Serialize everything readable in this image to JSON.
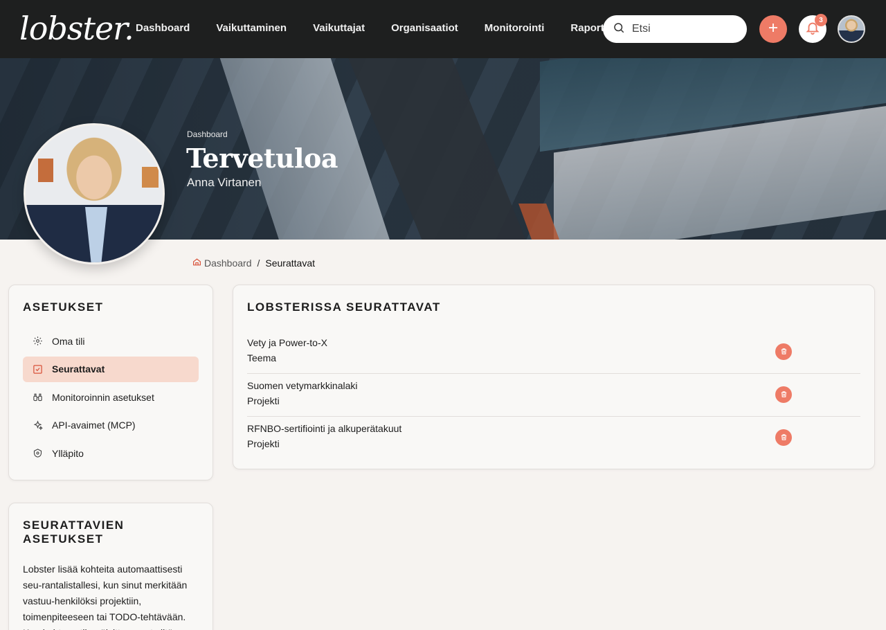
{
  "brand": {
    "logo_text": "lobster."
  },
  "nav": {
    "items": [
      "Dashboard",
      "Vaikuttaminen",
      "Vaikuttajat",
      "Organisaatiot",
      "Monitorointi",
      "Raportit"
    ]
  },
  "search": {
    "placeholder": "Etsi"
  },
  "notifications": {
    "count": "3"
  },
  "colors": {
    "accent": "#ee7b66",
    "active_bg": "#f7d9cd",
    "topbar": "#1e1f1f",
    "page_bg": "#f6f3f0"
  },
  "hero": {
    "crumb": "Dashboard",
    "title": "Tervetuloa",
    "subtitle": "Anna Virtanen"
  },
  "breadcrumb": {
    "home": "Dashboard",
    "separator": "/",
    "current": "Seurattavat"
  },
  "settings": {
    "title": "ASETUKSET",
    "items": [
      {
        "label": "Oma tili",
        "icon": "gear-icon"
      },
      {
        "label": "Seurattavat",
        "icon": "checkbox-icon",
        "active": true
      },
      {
        "label": "Monitoroinnin asetukset",
        "icon": "binoculars-icon"
      },
      {
        "label": "API-avaimet (MCP)",
        "icon": "sparkles-icon"
      },
      {
        "label": "Ylläpito",
        "icon": "shield-icon"
      }
    ]
  },
  "followed": {
    "title": "LOBSTERISSA SEURATTAVAT",
    "rows": [
      {
        "name": "Vety ja Power-to-X",
        "type": "Teema"
      },
      {
        "name": "Suomen vetymarkkinalaki",
        "type": "Projekti"
      },
      {
        "name": "RFNBO-sertifiointi ja alkuperätakuut",
        "type": "Projekti"
      }
    ]
  },
  "info": {
    "title": "SEURATTAVIEN ASETUKSET",
    "text": "Lobster lisää kohteita automaattisesti seu-rantalistallesi, kun sinut merkitään vastuu-henkilöksi projektiin, toimenpiteeseen tai TODO-tehtävään. Kun kohteen tila päivittyy, saat siitä ilmoituksen sekä sähköpostiisi"
  }
}
